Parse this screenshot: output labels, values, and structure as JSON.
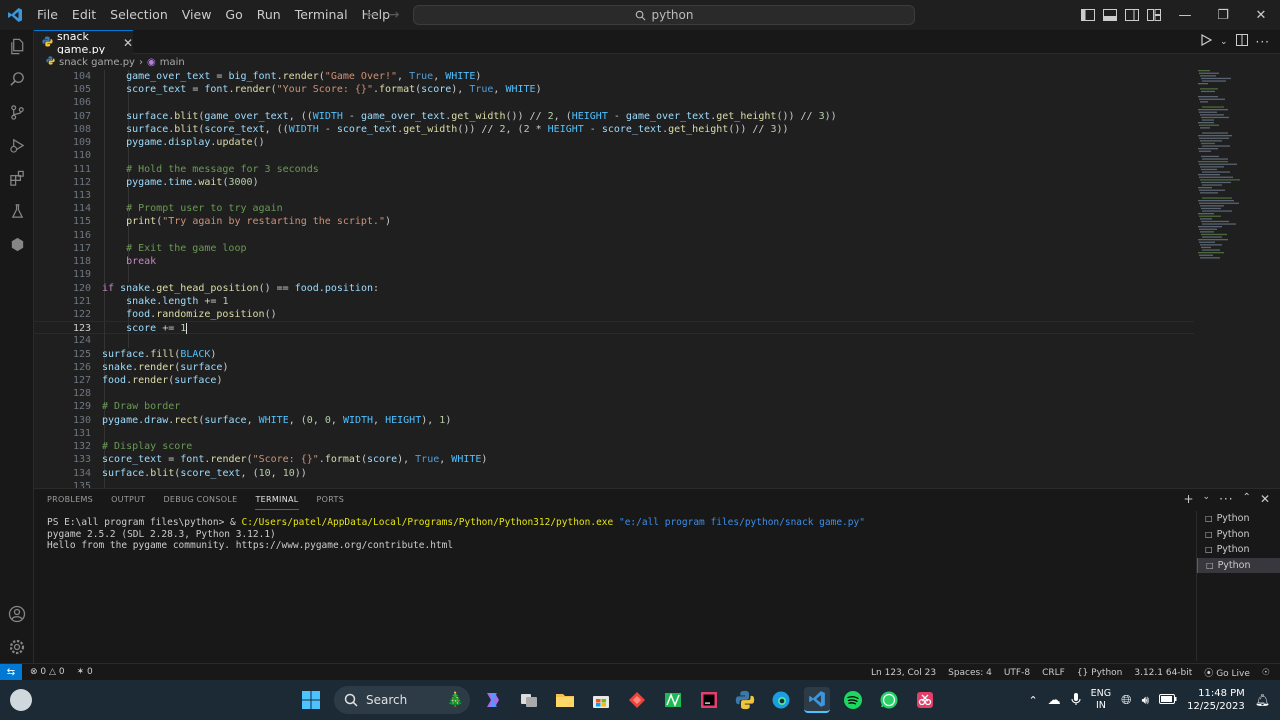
{
  "titlebar": {
    "menu": [
      "File",
      "Edit",
      "Selection",
      "View",
      "Go",
      "Run",
      "Terminal",
      "Help"
    ],
    "search": "python"
  },
  "tabs": [
    {
      "label": "snack game.py"
    }
  ],
  "breadcrumb": {
    "file": "snack game.py",
    "symbol": "main"
  },
  "code_lines": [
    {
      "n": "104",
      "text": "game_over_text = big_font.render(\"Game Over!\", True, WHITE)"
    },
    {
      "n": "105",
      "text": "score_text = font.render(\"Your Score: {}\".format(score), True, WHITE)"
    },
    {
      "n": "106",
      "text": ""
    },
    {
      "n": "107",
      "text": "surface.blit(game_over_text, ((WIDTH - game_over_text.get_width()) // 2, (HEIGHT - game_over_text.get_height()) // 3))"
    },
    {
      "n": "108",
      "text": "surface.blit(score_text, ((WIDTH - score_text.get_width()) // 2, (2 * HEIGHT - score_text.get_height()) // 3))"
    },
    {
      "n": "109",
      "text": "pygame.display.update()"
    },
    {
      "n": "110",
      "text": ""
    },
    {
      "n": "111",
      "text": "# Hold the message for 3 seconds"
    },
    {
      "n": "112",
      "text": "pygame.time.wait(3000)"
    },
    {
      "n": "113",
      "text": ""
    },
    {
      "n": "114",
      "text": "# Prompt user to try again"
    },
    {
      "n": "115",
      "text": "print(\"Try again by restarting the script.\")"
    },
    {
      "n": "116",
      "text": ""
    },
    {
      "n": "117",
      "text": "# Exit the game loop"
    },
    {
      "n": "118",
      "text": "break"
    },
    {
      "n": "119",
      "text": ""
    },
    {
      "n": "120",
      "text": "if snake.get_head_position() == food.position:"
    },
    {
      "n": "121",
      "text": "snake.length += 1"
    },
    {
      "n": "122",
      "text": "food.randomize_position()"
    },
    {
      "n": "123",
      "text": "score += 1"
    },
    {
      "n": "124",
      "text": ""
    },
    {
      "n": "125",
      "text": "surface.fill(BLACK)"
    },
    {
      "n": "126",
      "text": "snake.render(surface)"
    },
    {
      "n": "127",
      "text": "food.render(surface)"
    },
    {
      "n": "128",
      "text": ""
    },
    {
      "n": "129",
      "text": "# Draw border"
    },
    {
      "n": "130",
      "text": "pygame.draw.rect(surface, WHITE, (0, 0, WIDTH, HEIGHT), 1)"
    },
    {
      "n": "131",
      "text": ""
    },
    {
      "n": "132",
      "text": "# Display score"
    },
    {
      "n": "133",
      "text": "score_text = font.render(\"Score: {}\".format(score), True, WHITE)"
    },
    {
      "n": "134",
      "text": "surface.blit(score_text, (10, 10))"
    },
    {
      "n": "135",
      "text": ""
    }
  ],
  "panel": {
    "tabs": [
      "PROBLEMS",
      "OUTPUT",
      "DEBUG CONSOLE",
      "TERMINAL",
      "PORTS"
    ],
    "terminal_lines": {
      "prompt": "PS E:\\all program files\\python> & ",
      "exe": "C:/Users/patel/AppData/Local/Programs/Python/Python312/python.exe",
      "arg": "\"e:/all program files/python/snack game.py\"",
      "line2": "pygame 2.5.2 (SDL 2.28.3, Python 3.12.1)",
      "line3": "Hello from the pygame community. https://www.pygame.org/contribute.html"
    },
    "terminal_instances": [
      "Python",
      "Python",
      "Python",
      "Python"
    ]
  },
  "statusbar": {
    "errors": "0",
    "warnings": "0",
    "ports": "0",
    "position": "Ln 123, Col 23",
    "spaces": "Spaces: 4",
    "encoding": "UTF-8",
    "eol": "CRLF",
    "language": "Python",
    "interpreter": "3.12.1 64-bit",
    "golive": "Go Live"
  },
  "taskbar": {
    "search": "Search",
    "lang_top": "ENG",
    "lang_bottom": "IN",
    "time": "11:48 PM",
    "date": "12/25/2023"
  },
  "colors": {
    "accent": "#0078d4",
    "editor_bg": "#1f1f1f",
    "taskbar_bg": "#1c2a36"
  }
}
